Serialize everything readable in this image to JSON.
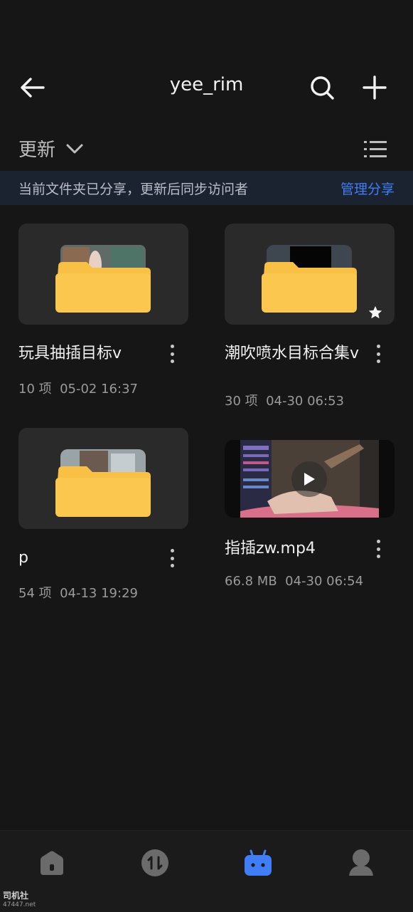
{
  "header": {
    "title": "yee_rim",
    "back_icon": "arrow-left-icon",
    "search_icon": "search-icon",
    "add_icon": "plus-icon"
  },
  "sort": {
    "label": "更新",
    "dropdown_icon": "chevron-down-icon",
    "view_icon": "list-view-icon"
  },
  "share_banner": {
    "text": "当前文件夹已分享，更新后同步访问者",
    "action": "管理分享"
  },
  "items": [
    {
      "name": "玩具抽插目标v",
      "meta": "10 项  05-02 16:37",
      "type": "folder",
      "starred": false
    },
    {
      "name": "潮吹喷水目标合集v",
      "meta": "30 项  04-30 06:53",
      "type": "folder",
      "starred": true
    },
    {
      "name": "p",
      "meta": "54 项  04-13 19:29",
      "type": "folder",
      "starred": false
    },
    {
      "name": "指插zw.mp4",
      "meta": "66.8 MB  04-30 06:54",
      "type": "video",
      "starred": false
    }
  ],
  "bottom_nav": [
    {
      "icon": "home-icon",
      "active": false
    },
    {
      "icon": "transfer-icon",
      "active": false
    },
    {
      "icon": "share-box-icon",
      "active": true
    },
    {
      "icon": "profile-icon",
      "active": false
    }
  ],
  "watermark": {
    "line1": "司机社",
    "line2": "47447.net"
  },
  "colors": {
    "background": "#161616",
    "accent": "#3f7ef6",
    "folder": "#f8c146",
    "banner_bg": "#1c2330"
  }
}
